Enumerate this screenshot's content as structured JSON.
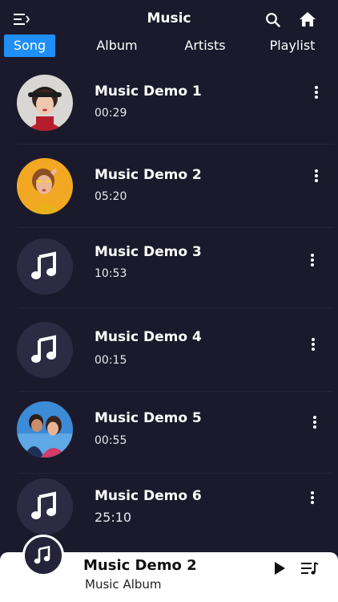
{
  "header": {
    "title": "Music",
    "menu_icon": "menu-icon",
    "search_icon": "search-icon",
    "home_icon": "home-icon"
  },
  "tabs": [
    {
      "label": "Song",
      "active": true
    },
    {
      "label": "Album",
      "active": false
    },
    {
      "label": "Artists",
      "active": false
    },
    {
      "label": "Playlist",
      "active": false
    }
  ],
  "songs": [
    {
      "title": "Music Demo 1",
      "duration": "00:29",
      "art": "woman-red-cap-photo"
    },
    {
      "title": "Music Demo 2",
      "duration": "05:20",
      "art": "woman-yellow-photo"
    },
    {
      "title": "Music Demo 3",
      "duration": "10:53",
      "art": "music-note-icon"
    },
    {
      "title": "Music Demo 4",
      "duration": "00:15",
      "art": "music-note-icon"
    },
    {
      "title": "Music Demo 5",
      "duration": "00:55",
      "art": "couple-photo"
    },
    {
      "title": "Music Demo 6",
      "duration": "25:10",
      "art": "music-note-icon"
    }
  ],
  "now_playing": {
    "title": "Music Demo 2",
    "subtitle": "Music Album",
    "play_icon": "play-icon",
    "queue_icon": "queue-icon"
  },
  "colors": {
    "background": "#1b1a2c",
    "accent": "#1f8ff5",
    "player_bg": "#ffffff"
  }
}
